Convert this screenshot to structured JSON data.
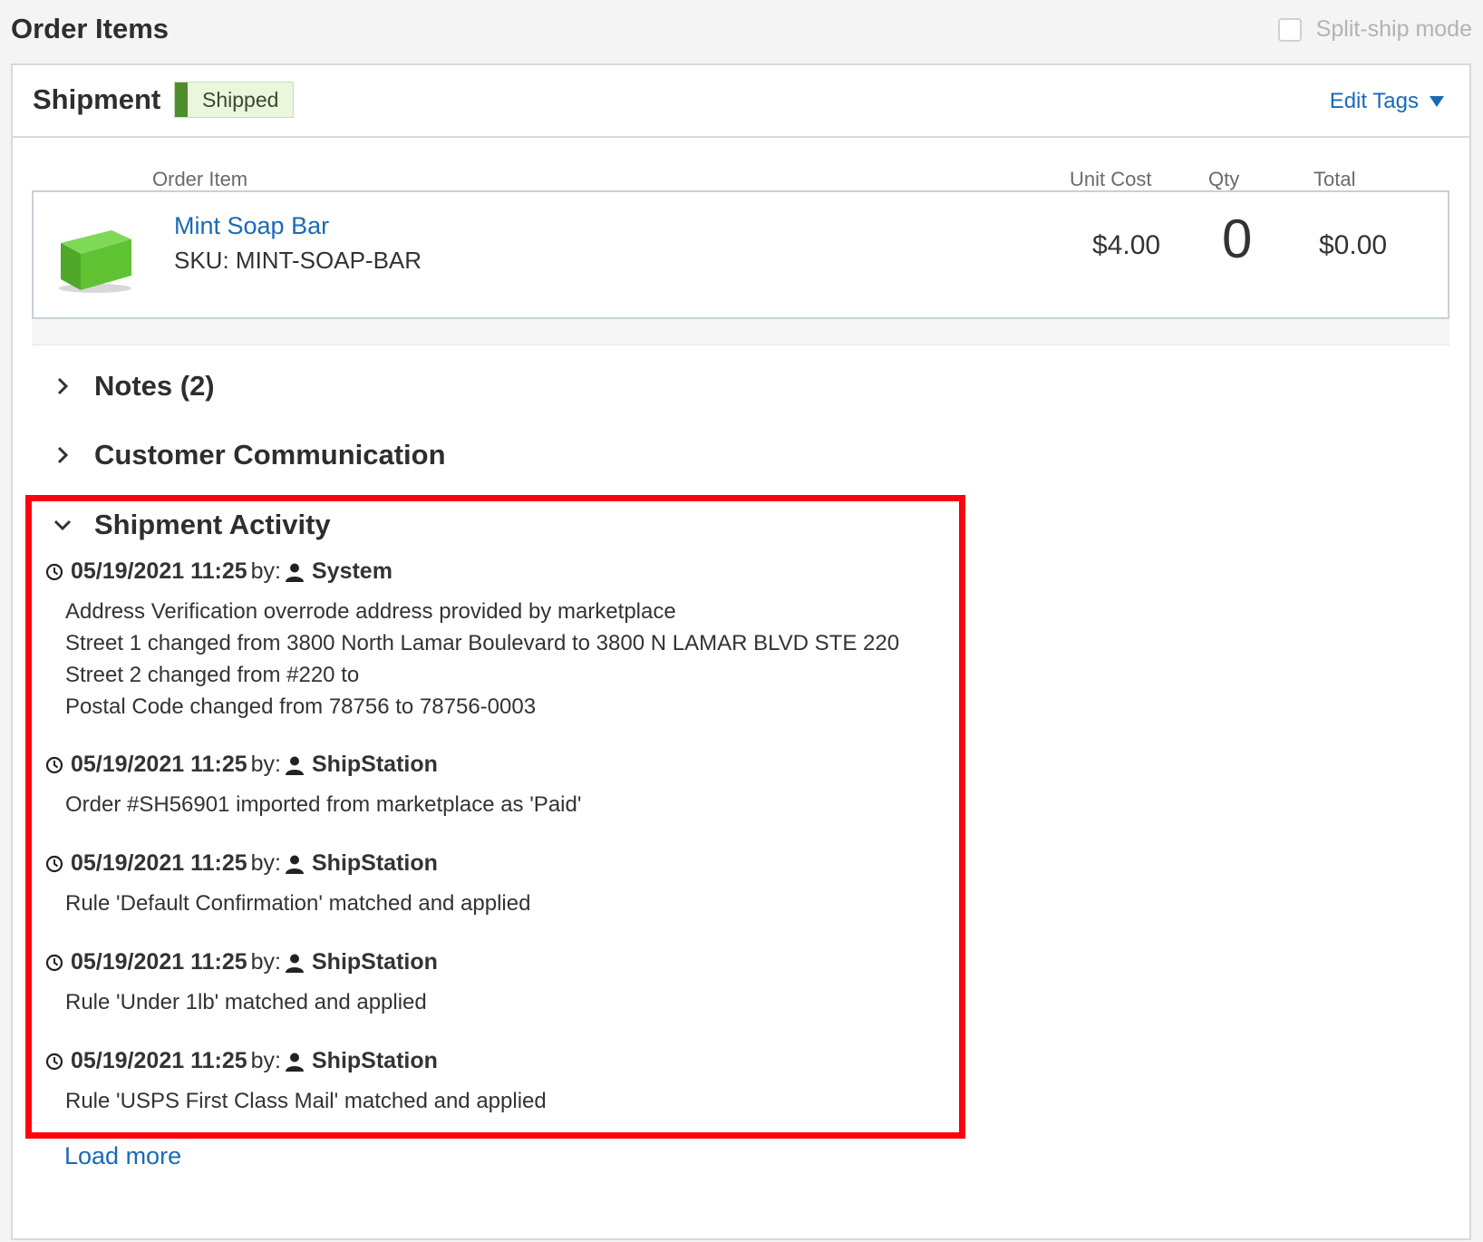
{
  "header": {
    "title": "Order Items",
    "split_ship_label": "Split-ship mode",
    "split_ship_checked": false
  },
  "shipment": {
    "title": "Shipment",
    "status": "Shipped",
    "status_color": "#4f8d2e",
    "edit_tags_label": "Edit Tags"
  },
  "items_table": {
    "columns": [
      "Order Item",
      "Unit Cost",
      "Qty",
      "Total"
    ],
    "rows": [
      {
        "name": "Mint Soap Bar",
        "sku": "SKU: MINT-SOAP-BAR",
        "unit_cost": "$4.00",
        "qty": "0",
        "total": "$0.00",
        "thumbnail": "green-soap-bar-image"
      }
    ]
  },
  "sections": [
    {
      "label": "Notes (2)",
      "expanded": false
    },
    {
      "label": "Customer Communication",
      "expanded": false
    },
    {
      "label": "Shipment Activity",
      "expanded": true
    }
  ],
  "activity": [
    {
      "timestamp": "05/19/2021 11:25",
      "by": "by:",
      "actor": "System",
      "lines": [
        "Address Verification overrode address provided by marketplace",
        "Street 1 changed from 3800 North Lamar Boulevard to 3800 N LAMAR BLVD STE 220",
        "Street 2 changed from #220 to",
        "Postal Code changed from 78756 to 78756-0003"
      ]
    },
    {
      "timestamp": "05/19/2021 11:25",
      "by": "by:",
      "actor": "ShipStation",
      "lines": [
        "Order #SH56901 imported from marketplace as 'Paid'"
      ]
    },
    {
      "timestamp": "05/19/2021 11:25",
      "by": "by:",
      "actor": "ShipStation",
      "lines": [
        "Rule 'Default Confirmation' matched and applied"
      ]
    },
    {
      "timestamp": "05/19/2021 11:25",
      "by": "by:",
      "actor": "ShipStation",
      "lines": [
        "Rule 'Under 1lb' matched and applied"
      ]
    },
    {
      "timestamp": "05/19/2021 11:25",
      "by": "by:",
      "actor": "ShipStation",
      "lines": [
        "Rule 'USPS First Class Mail' matched and applied"
      ]
    }
  ],
  "load_more_label": "Load more",
  "colors": {
    "link": "#1a6ab8",
    "highlight_box": "#ff0012"
  }
}
